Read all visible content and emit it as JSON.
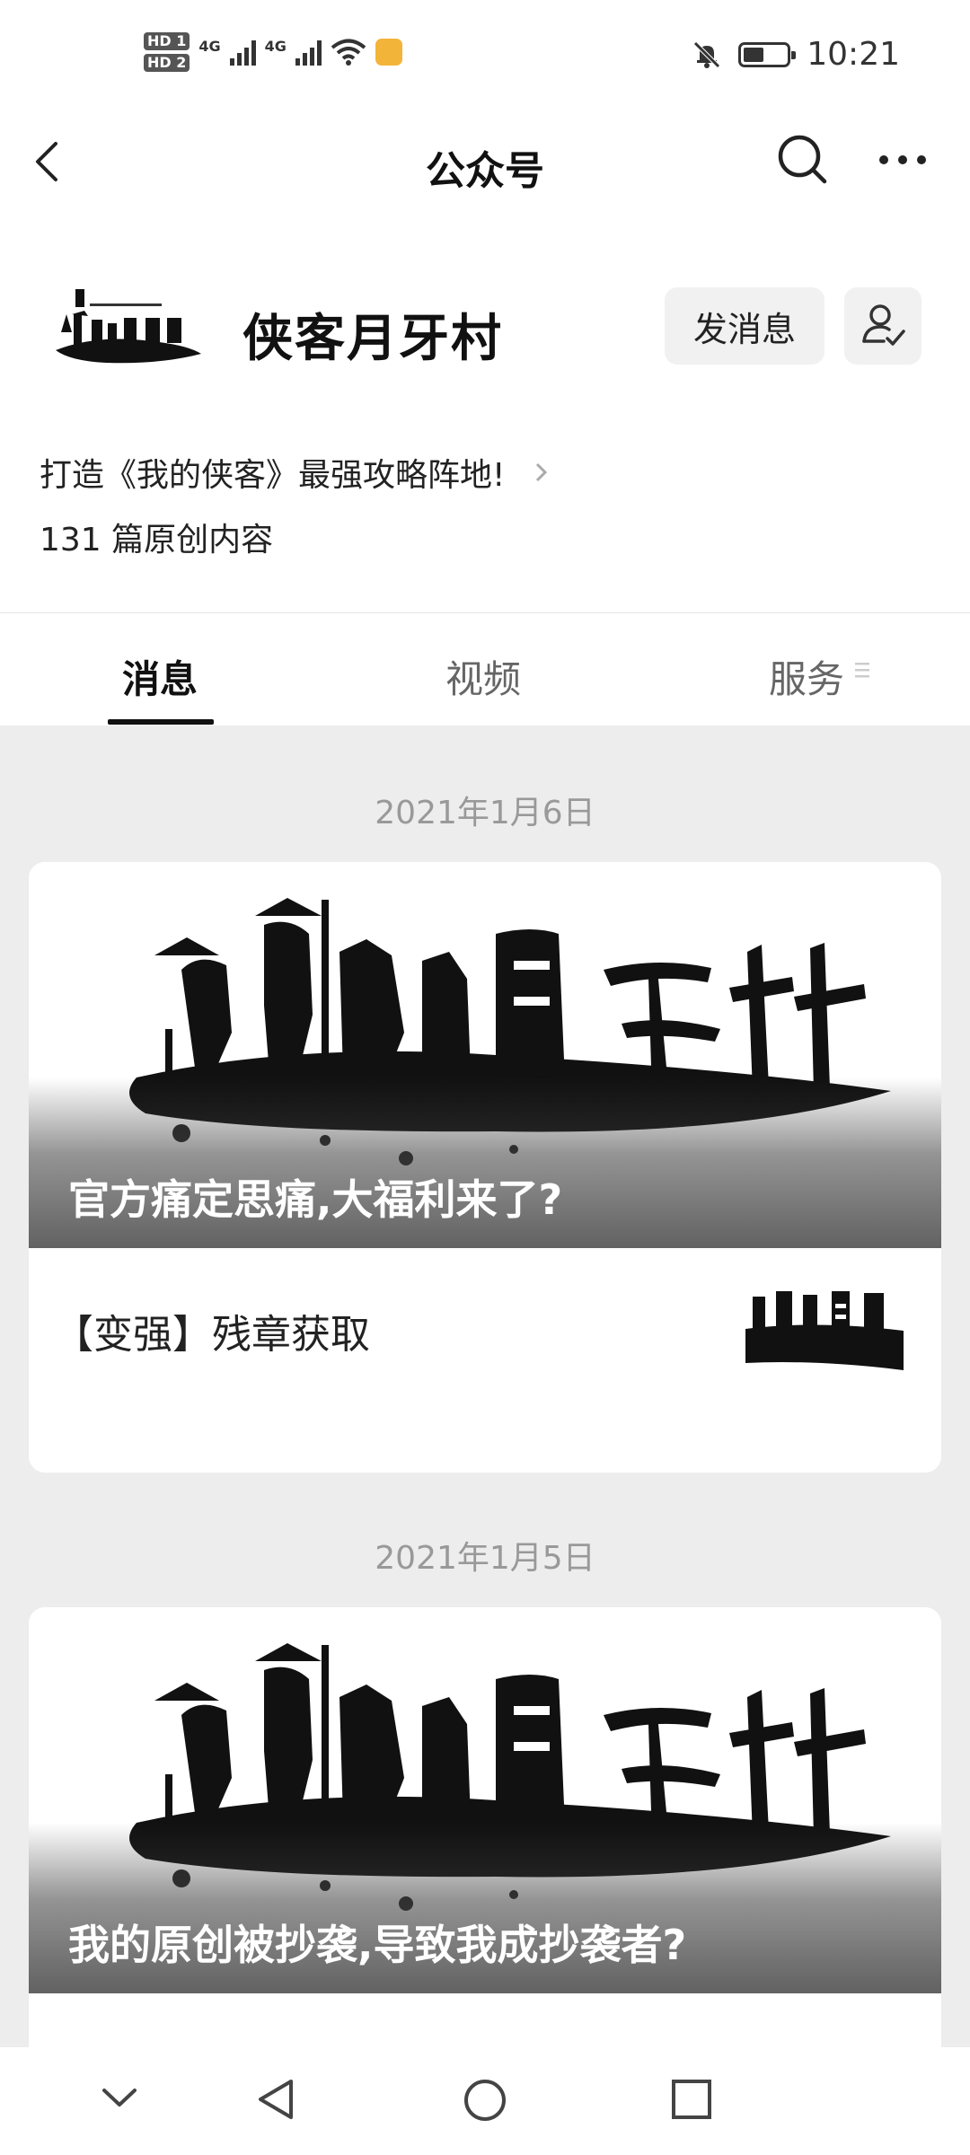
{
  "status_bar": {
    "hd1": "HD 1",
    "hd2": "HD 2",
    "net1": "4G",
    "net2": "4G",
    "time": "10:21"
  },
  "nav": {
    "title": "公众号"
  },
  "profile": {
    "name": "侠客月牙村",
    "message_button": "发消息",
    "description": "打造《我的侠客》最强攻略阵地!",
    "original_count": "131 篇原创内容"
  },
  "tabs": [
    {
      "label": "消息",
      "active": true
    },
    {
      "label": "视频",
      "active": false
    },
    {
      "label": "服务",
      "active": false
    }
  ],
  "posts": [
    {
      "date": "2021年1月6日",
      "cover_title": "官方痛定思痛,大福利来了?",
      "sub_title": "【变强】残章获取"
    },
    {
      "date": "2021年1月5日",
      "cover_title": "我的原创被抄袭,导致我成抄袭者?"
    }
  ],
  "icons": {
    "back": "back-arrow-icon",
    "search": "search-icon",
    "more": "more-icon",
    "follow": "user-check-icon"
  }
}
